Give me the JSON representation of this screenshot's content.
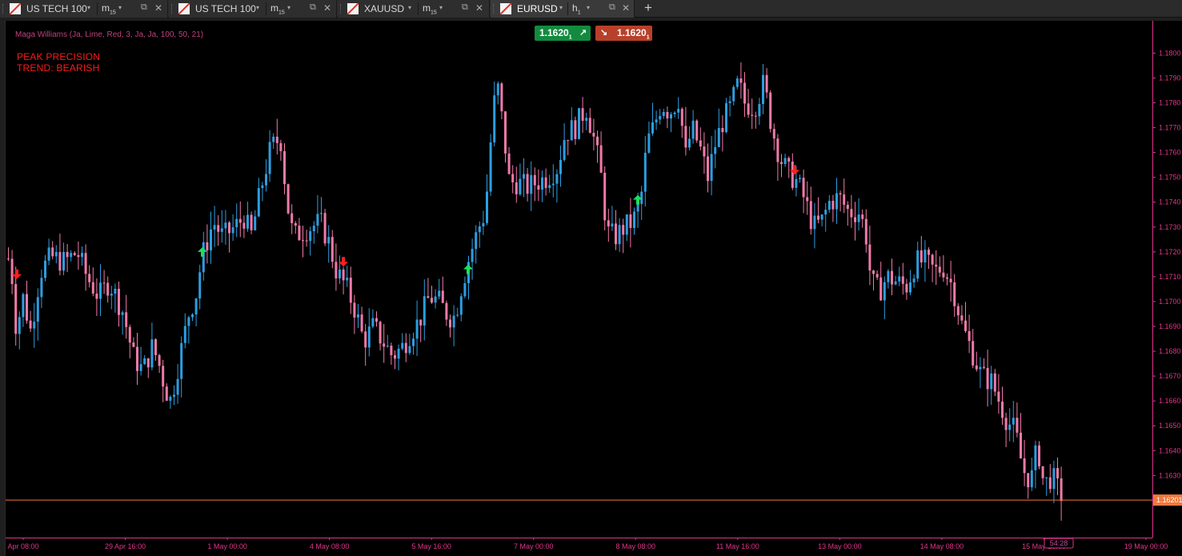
{
  "tabs": [
    {
      "symbol": "US TECH 100",
      "timeframe": "m",
      "timeframe_sub": "15",
      "active": false
    },
    {
      "symbol": "US TECH 100",
      "timeframe": "m",
      "timeframe_sub": "15",
      "active": false
    },
    {
      "symbol": "XAUUSD",
      "timeframe": "m",
      "timeframe_sub": "15",
      "active": false
    },
    {
      "symbol": "EURUSD",
      "timeframe": "h",
      "timeframe_sub": "1",
      "active": true
    }
  ],
  "tab_controls": {
    "dropdown": "▾",
    "detach": "⧉",
    "close": "✕",
    "add": "+"
  },
  "indicator": {
    "label": "Maga Williams (Ja, Lime, Red, 3, Ja, Ja, 100, 50, 21)",
    "color": "#c0407e"
  },
  "signal": {
    "title": "PEAK PRECISION",
    "trend": "TREND: BEARISH",
    "color": "#ff1a1a"
  },
  "quick_trade": {
    "buy_price_main": "1.1620",
    "buy_price_sub": "1",
    "buy_arrow": "↗",
    "sell_price_main": "1.1620",
    "sell_price_sub": "1",
    "sell_arrow": "↘",
    "buy_color": "#138a3f",
    "sell_color": "#b8402a"
  },
  "chart_data": {
    "type": "candlestick",
    "symbol": "EURUSD",
    "timeframe": "h1",
    "ylim": [
      1.1605,
      1.1813
    ],
    "y_ticks": [
      "1.1630",
      "1.1640",
      "1.1650",
      "1.1660",
      "1.1670",
      "1.1680",
      "1.1690",
      "1.1700",
      "1.1710",
      "1.1720",
      "1.1730",
      "1.1740",
      "1.1750",
      "1.1760",
      "1.1770",
      "1.1780",
      "1.1790",
      "1.1800"
    ],
    "x_labels": [
      "Apr 08:00",
      "29 Apr 16:00",
      "1 May 00:00",
      "4 May 08:00",
      "5 May 16:00",
      "7 May 00:00",
      "8 May 08:00",
      "11 May 16:00",
      "13 May 00:00",
      "14 May 08:00",
      "15 May 16:00",
      "19 May 00:00"
    ],
    "current_price": 1.16201,
    "current_price_label": "1.16201",
    "countdown_label": "54:28",
    "colors": {
      "bull": "#2c9ee0",
      "bear": "#f07aa8",
      "axis_text": "#e0358a",
      "price_line": "#f0783c"
    },
    "path": [
      [
        0,
        1.172
      ],
      [
        6,
        1.1712
      ],
      [
        12,
        1.1688
      ],
      [
        20,
        1.1702
      ],
      [
        30,
        1.1688
      ],
      [
        42,
        1.1712
      ],
      [
        55,
        1.1718
      ],
      [
        72,
        1.1716
      ],
      [
        88,
        1.172
      ],
      [
        100,
        1.171
      ],
      [
        115,
        1.1702
      ],
      [
        128,
        1.1708
      ],
      [
        145,
        1.1696
      ],
      [
        158,
        1.1678
      ],
      [
        170,
        1.1672
      ],
      [
        182,
        1.1682
      ],
      [
        190,
        1.1675
      ],
      [
        198,
        1.1665
      ],
      [
        205,
        1.166
      ],
      [
        215,
        1.1676
      ],
      [
        228,
        1.1696
      ],
      [
        236,
        1.1702
      ],
      [
        244,
        1.1718
      ],
      [
        258,
        1.1732
      ],
      [
        270,
        1.1726
      ],
      [
        285,
        1.173
      ],
      [
        297,
        1.1734
      ],
      [
        305,
        1.1726
      ],
      [
        318,
        1.1746
      ],
      [
        330,
        1.1762
      ],
      [
        342,
        1.1766
      ],
      [
        350,
        1.174
      ],
      [
        358,
        1.1726
      ],
      [
        368,
        1.1728
      ],
      [
        380,
        1.173
      ],
      [
        392,
        1.1732
      ],
      [
        402,
        1.1724
      ],
      [
        412,
        1.1712
      ],
      [
        424,
        1.1706
      ],
      [
        436,
        1.1696
      ],
      [
        446,
        1.1684
      ],
      [
        458,
        1.169
      ],
      [
        470,
        1.1684
      ],
      [
        482,
        1.1678
      ],
      [
        495,
        1.1682
      ],
      [
        505,
        1.1688
      ],
      [
        515,
        1.1692
      ],
      [
        528,
        1.1702
      ],
      [
        540,
        1.17
      ],
      [
        552,
        1.1694
      ],
      [
        560,
        1.1694
      ],
      [
        568,
        1.1706
      ],
      [
        578,
        1.1718
      ],
      [
        590,
        1.173
      ],
      [
        598,
        1.1736
      ],
      [
        604,
        1.1762
      ],
      [
        612,
        1.179
      ],
      [
        620,
        1.177
      ],
      [
        628,
        1.1748
      ],
      [
        638,
        1.1748
      ],
      [
        650,
        1.1746
      ],
      [
        662,
        1.1748
      ],
      [
        675,
        1.175
      ],
      [
        688,
        1.1754
      ],
      [
        698,
        1.1768
      ],
      [
        710,
        1.177
      ],
      [
        724,
        1.1778
      ],
      [
        732,
        1.1768
      ],
      [
        742,
        1.1752
      ],
      [
        750,
        1.1728
      ],
      [
        760,
        1.1726
      ],
      [
        772,
        1.173
      ],
      [
        782,
        1.1732
      ],
      [
        792,
        1.174
      ],
      [
        800,
        1.1764
      ],
      [
        808,
        1.177
      ],
      [
        818,
        1.178
      ],
      [
        828,
        1.1776
      ],
      [
        840,
        1.1782
      ],
      [
        848,
        1.1758
      ],
      [
        856,
        1.177
      ],
      [
        866,
        1.1762
      ],
      [
        876,
        1.175
      ],
      [
        884,
        1.1762
      ],
      [
        894,
        1.1772
      ],
      [
        904,
        1.1778
      ],
      [
        914,
        1.1788
      ],
      [
        922,
        1.178
      ],
      [
        934,
        1.1778
      ],
      [
        946,
        1.1788
      ],
      [
        956,
        1.177
      ],
      [
        966,
        1.1758
      ],
      [
        976,
        1.1752
      ],
      [
        988,
        1.1748
      ],
      [
        998,
        1.174
      ],
      [
        1008,
        1.173
      ],
      [
        1018,
        1.1732
      ],
      [
        1028,
        1.174
      ],
      [
        1040,
        1.1742
      ],
      [
        1052,
        1.1736
      ],
      [
        1066,
        1.1736
      ],
      [
        1074,
        1.1726
      ],
      [
        1080,
        1.1708
      ],
      [
        1090,
        1.1704
      ],
      [
        1100,
        1.171
      ],
      [
        1112,
        1.1708
      ],
      [
        1124,
        1.1706
      ],
      [
        1136,
        1.1716
      ],
      [
        1148,
        1.1716
      ],
      [
        1160,
        1.1712
      ],
      [
        1170,
        1.1714
      ],
      [
        1182,
        1.1706
      ],
      [
        1194,
        1.169
      ],
      [
        1206,
        1.168
      ],
      [
        1218,
        1.167
      ],
      [
        1230,
        1.1668
      ],
      [
        1240,
        1.166
      ],
      [
        1250,
        1.1652
      ],
      [
        1260,
        1.1648
      ],
      [
        1270,
        1.1632
      ],
      [
        1280,
        1.1628
      ],
      [
        1288,
        1.1642
      ],
      [
        1296,
        1.1626
      ],
      [
        1306,
        1.163
      ],
      [
        1314,
        1.1624
      ],
      [
        1322,
        1.162
      ]
    ],
    "signal_arrows": [
      {
        "x": 14,
        "price": 1.1711,
        "direction": "down"
      },
      {
        "x": 246,
        "price": 1.172,
        "direction": "up"
      },
      {
        "x": 422,
        "price": 1.1716,
        "direction": "down"
      },
      {
        "x": 578,
        "price": 1.1713,
        "direction": "up"
      },
      {
        "x": 790,
        "price": 1.1741,
        "direction": "up"
      },
      {
        "x": 986,
        "price": 1.1753,
        "direction": "down"
      }
    ]
  }
}
